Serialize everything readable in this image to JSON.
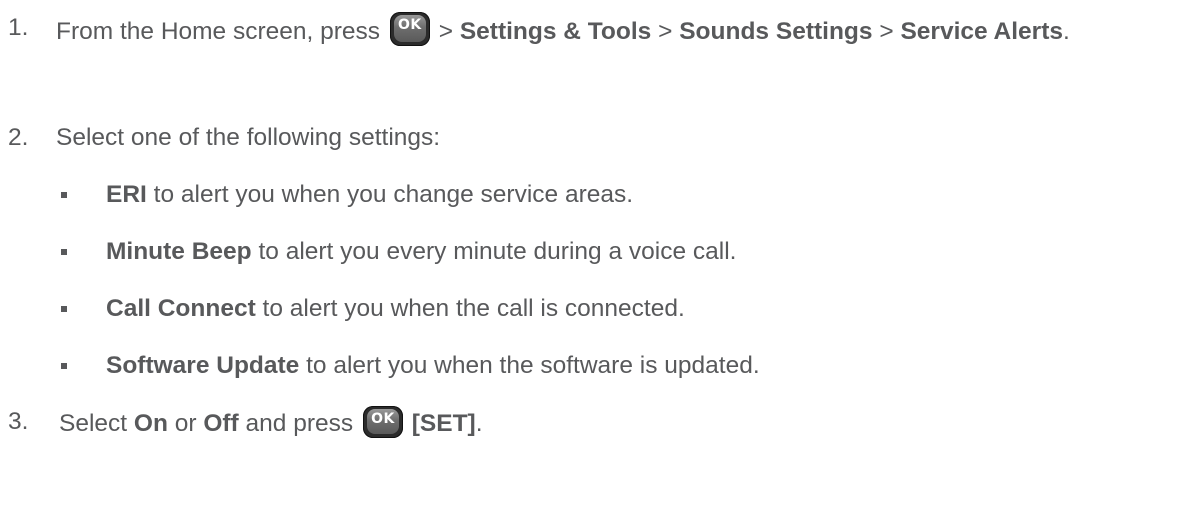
{
  "step1": {
    "number": "1.",
    "prefix": "From the Home screen, press",
    "key_label": "OK",
    "sep1": ">",
    "menu1": "Settings & Tools",
    "sep2": ">",
    "menu2": "Sounds Settings",
    "sep3": ">",
    "menu3": "Service Alerts",
    "end": "."
  },
  "step2": {
    "number": "2.",
    "text": "Select one of the following settings:"
  },
  "bullets": [
    {
      "term": "ERI",
      "desc": " to alert you when you change service areas."
    },
    {
      "term": "Minute Beep",
      "desc": " to alert you every minute during a voice call."
    },
    {
      "term": "Call Connect",
      "desc": " to alert you when the call is connected."
    },
    {
      "term": "Software Update",
      "desc": " to alert you when the software is updated."
    }
  ],
  "step3": {
    "number": "3.",
    "prefix": "Select ",
    "on": "On",
    "or": " or ",
    "off": "Off",
    "mid": " and press",
    "key_label": "OK",
    "set": "[SET]",
    "end": "."
  }
}
